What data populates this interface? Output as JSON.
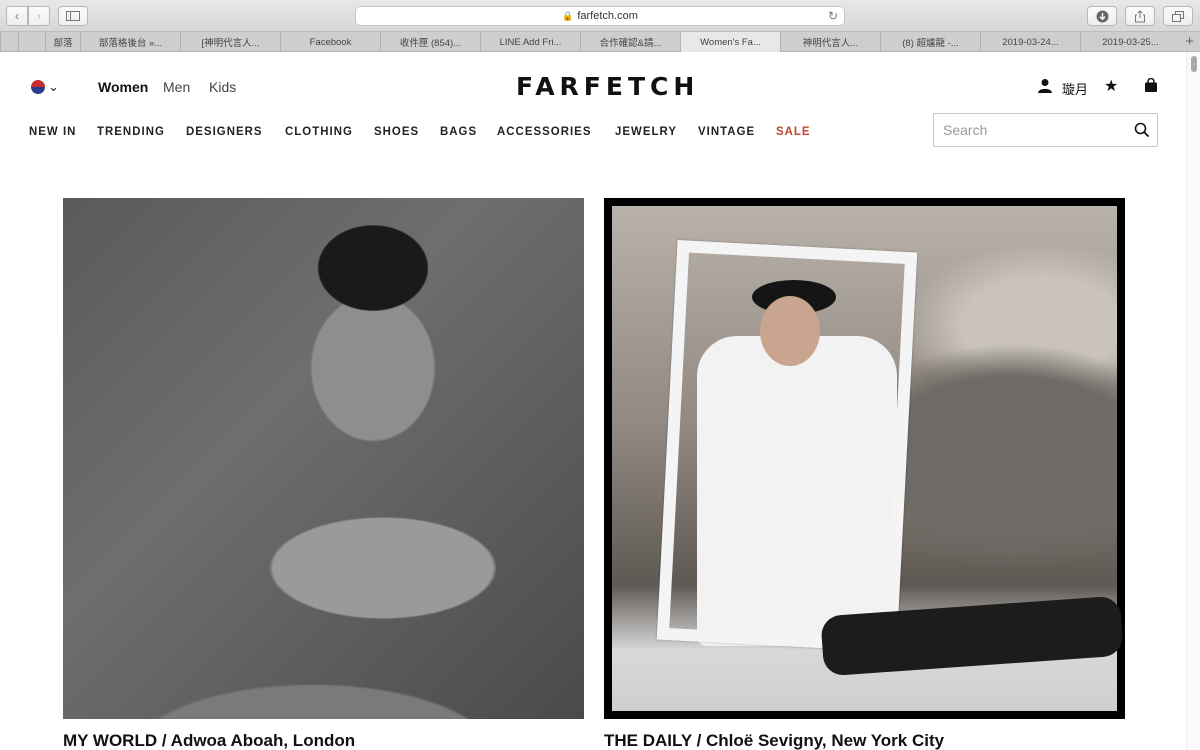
{
  "browser": {
    "url": "farfetch.com",
    "tabs": [
      "部落",
      "部落格後台 »...",
      "[神明代言人...",
      "Facebook",
      "收件匣 (854)...",
      "LINE Add Fri...",
      "合作確認&請...",
      "Women's Fa...",
      "神明代言人...",
      "(8) 超爐龍 -...",
      "2019-03-24...",
      "2019-03-25..."
    ],
    "active_tab_index": 7
  },
  "header": {
    "logo": "FARFETCH",
    "gender_tabs": [
      "Women",
      "Men",
      "Kids"
    ],
    "active_gender": "Women",
    "user_name": "璇月"
  },
  "nav": {
    "items": [
      "NEW IN",
      "TRENDING",
      "DESIGNERS",
      "CLOTHING",
      "SHOES",
      "BAGS",
      "ACCESSORIES",
      "JEWELRY",
      "VINTAGE",
      "SALE"
    ],
    "sale_color": "#c0452d"
  },
  "search": {
    "placeholder": "Search",
    "value": ""
  },
  "cards": [
    {
      "caption": "MY WORLD / Adwoa Aboah, London"
    },
    {
      "caption": "THE DAILY / Chloë Sevigny, New York City"
    }
  ]
}
